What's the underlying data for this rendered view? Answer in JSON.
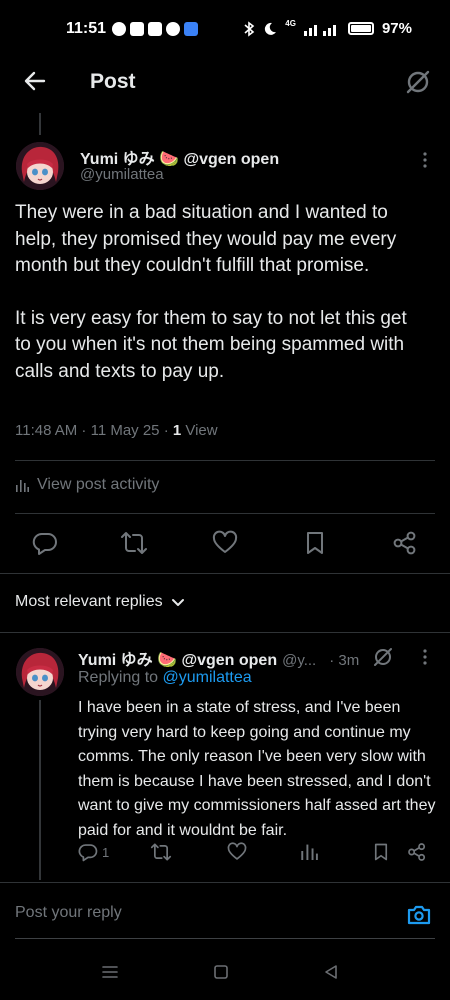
{
  "status_bar": {
    "time": "11:51",
    "network_label": "4G",
    "battery": "97%"
  },
  "header": {
    "title": "Post"
  },
  "post": {
    "author_name": "Yumi ゆみ 🍉 @vgen open",
    "author_handle": "@yumilattea",
    "paragraphs": [
      "They were in a bad situation and I wanted to help, they promised they would pay me every month but they couldn't fulfill that promise.",
      "It is very easy for them to say to not let this get to you when it's not them being spammed with calls and texts to pay up."
    ],
    "timestamp": "11:48 AM · 11 May 25 · ",
    "views_count": "1",
    "views_label": " View",
    "activity_label": "View post activity"
  },
  "replies": {
    "sort_label": "Most relevant replies",
    "items": [
      {
        "author_name": "Yumi ゆみ 🍉 @vgen open",
        "author_handle": "@y...",
        "time": "· 3m",
        "replying_prefix": "Replying to ",
        "replying_to": "@yumilattea",
        "text": "I have been in a state of stress, and I've been trying very hard to keep going and continue my comms. The only reason I've been very slow with them is because I have been stressed, and I don't want to give my commissioners half assed art they paid for and it wouldnt be fair.",
        "reply_count": "1"
      }
    ]
  },
  "compose": {
    "placeholder": "Post your reply"
  },
  "colors": {
    "background": "#000000",
    "text": "#e7e9ea",
    "muted": "#71767b",
    "accent": "#1d9bf0",
    "divider": "#2f3336"
  }
}
